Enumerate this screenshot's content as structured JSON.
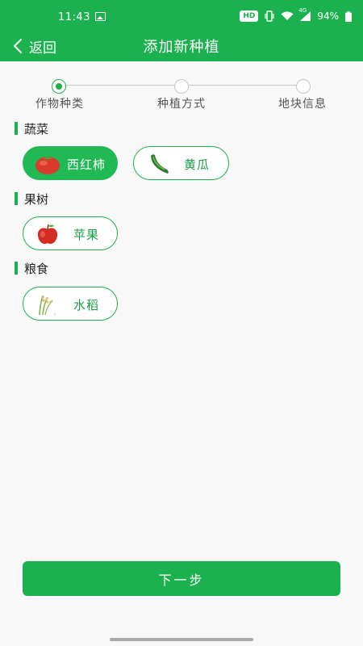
{
  "status_bar": {
    "time": "11:43",
    "hd_badge": "HD",
    "network": "4G",
    "battery": "94%",
    "icons": [
      "image-icon",
      "vibrate-icon",
      "wifi-icon",
      "signal-icon",
      "battery-icon"
    ]
  },
  "app_bar": {
    "back_label": "返回",
    "title": "添加新种植"
  },
  "stepper": {
    "steps": [
      {
        "label": "作物种类",
        "active": true
      },
      {
        "label": "种植方式",
        "active": false
      },
      {
        "label": "地块信息",
        "active": false
      }
    ]
  },
  "sections": [
    {
      "title": "蔬菜",
      "crops": [
        {
          "label": "西红柿",
          "icon": "tomato-icon",
          "selected": true
        },
        {
          "label": "黄瓜",
          "icon": "cucumber-icon",
          "selected": false
        }
      ]
    },
    {
      "title": "果树",
      "crops": [
        {
          "label": "苹果",
          "icon": "apple-icon",
          "selected": false
        }
      ]
    },
    {
      "title": "粮食",
      "crops": [
        {
          "label": "水稻",
          "icon": "rice-icon",
          "selected": false
        }
      ]
    }
  ],
  "next_button": {
    "label": "下一步"
  },
  "colors": {
    "primary": "#1cb14f",
    "chip_text": "#1a9c46",
    "background": "#f8f8f8"
  }
}
